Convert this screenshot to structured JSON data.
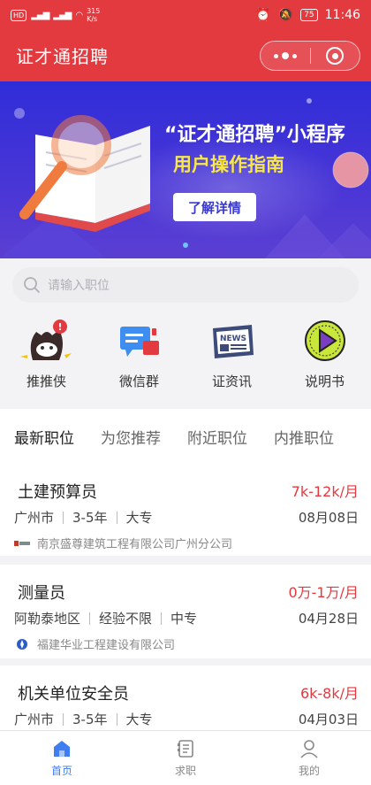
{
  "status_bar": {
    "left_badge": "HD",
    "network_speed_value": "315",
    "network_speed_unit": "K/s",
    "battery": "75",
    "time": "11:46"
  },
  "header": {
    "title": "证才通招聘"
  },
  "banner": {
    "headline": "“证才通招聘”小程序",
    "subheadline": "用户操作指南",
    "cta_label": "了解详情"
  },
  "search": {
    "placeholder": "请输入职位"
  },
  "quick_links": [
    {
      "label": "推推侠",
      "icon": "mascot-notification-icon"
    },
    {
      "label": "微信群",
      "icon": "chat-group-icon"
    },
    {
      "label": "证资讯",
      "icon": "news-icon"
    },
    {
      "label": "说明书",
      "icon": "play-manual-icon"
    }
  ],
  "tabs": [
    {
      "label": "最新职位",
      "active": true
    },
    {
      "label": "为您推荐",
      "active": false
    },
    {
      "label": "附近职位",
      "active": false
    },
    {
      "label": "内推职位",
      "active": false
    }
  ],
  "jobs": [
    {
      "title": "土建预算员",
      "salary": "7k-12k/月",
      "location": "广州市",
      "experience": "3-5年",
      "education": "大专",
      "date": "08月08日",
      "company": "南京盛尊建筑工程有限公司广州分公司"
    },
    {
      "title": "测量员",
      "salary": "0万-1万/月",
      "location": "阿勒泰地区",
      "experience": "经验不限",
      "education": "中专",
      "date": "04月28日",
      "company": "福建华业工程建设有限公司"
    },
    {
      "title": "机关单位安全员",
      "salary": "6k-8k/月",
      "location": "广州市",
      "experience": "3-5年",
      "education": "大专",
      "date": "04月03日",
      "company": ""
    }
  ],
  "bottom_nav": [
    {
      "label": "首页",
      "active": true
    },
    {
      "label": "求职",
      "active": false
    },
    {
      "label": "我的",
      "active": false
    }
  ],
  "colors": {
    "brand_red": "#e23a3f",
    "banner_blue": "#3a33d6",
    "banner_yellow": "#f7e74a",
    "nav_active_blue": "#3f7ef0"
  }
}
